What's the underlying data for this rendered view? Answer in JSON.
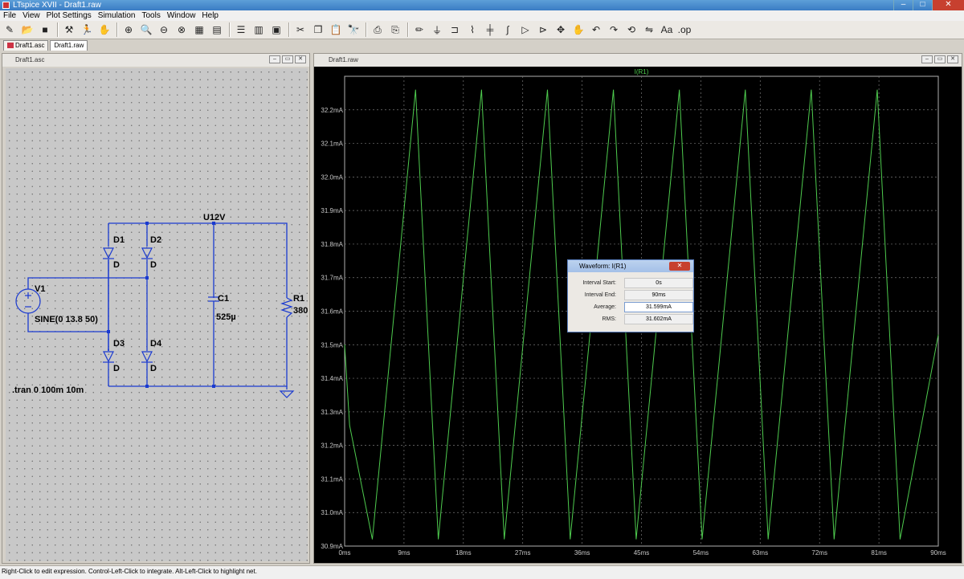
{
  "window": {
    "title": "LTspice XVII - Draft1.raw"
  },
  "menu": [
    "File",
    "View",
    "Plot Settings",
    "Simulation",
    "Tools",
    "Window",
    "Help"
  ],
  "tabs": [
    "Draft1.asc",
    "Draft1.raw"
  ],
  "schematic": {
    "title": "Draft1.asc",
    "net_label": "U12V",
    "diodes": [
      {
        "name": "D1",
        "value": "D"
      },
      {
        "name": "D2",
        "value": "D"
      },
      {
        "name": "D3",
        "value": "D"
      },
      {
        "name": "D4",
        "value": "D"
      }
    ],
    "source": {
      "name": "V1",
      "value": "SINE(0 13.8 50)"
    },
    "capacitor": {
      "name": "C1",
      "value": "525µ"
    },
    "resistor": {
      "name": "R1",
      "value": "380"
    },
    "directive": ".tran 0 100m 10m"
  },
  "waveform_window": {
    "title": "Draft1.raw"
  },
  "chart_data": {
    "type": "line",
    "title": "I(R1)",
    "xlabel": "",
    "ylabel": "",
    "x_ticks": [
      "0ms",
      "9ms",
      "18ms",
      "27ms",
      "36ms",
      "45ms",
      "54ms",
      "63ms",
      "72ms",
      "81ms",
      "90ms"
    ],
    "y_ticks": [
      "30.9mA",
      "31.0mA",
      "31.1mA",
      "31.2mA",
      "31.3mA",
      "31.4mA",
      "31.5mA",
      "31.6mA",
      "31.7mA",
      "31.8mA",
      "31.9mA",
      "32.0mA",
      "32.1mA",
      "32.2mA"
    ],
    "xlim": [
      0,
      90
    ],
    "ylim": [
      30.9,
      32.3
    ],
    "grid": true,
    "trace_color": "#4ecb4e",
    "series": [
      {
        "name": "I(R1)",
        "x": [
          0,
          0.75,
          4.2,
          10.75,
          14.2,
          20.75,
          24.2,
          30.75,
          34.2,
          40.75,
          44.2,
          50.75,
          54.2,
          60.75,
          64.2,
          70.75,
          74.2,
          80.75,
          84.2,
          90
        ],
        "values": [
          31.5,
          31.26,
          30.92,
          32.26,
          30.92,
          32.26,
          30.92,
          32.26,
          30.92,
          32.26,
          30.92,
          32.26,
          30.92,
          32.26,
          30.92,
          32.26,
          30.92,
          32.26,
          30.92,
          31.53
        ]
      }
    ]
  },
  "dialog": {
    "title": "Waveform: I(R1)",
    "close": "✕",
    "fields": [
      {
        "label": "Interval Start:",
        "value": "0s"
      },
      {
        "label": "Interval End:",
        "value": "90ms"
      },
      {
        "label": "Average:",
        "value": "31.599mA"
      },
      {
        "label": "RMS:",
        "value": "31.602mA"
      }
    ]
  },
  "status": "Right-Click to edit expression. Control-Left-Click to integrate. Alt-Left-Click to highlight net.",
  "colors": {
    "wire": "#1a3ad0",
    "trace": "#4ecb4e",
    "axis": "#b0b0b0",
    "close": "#c7402f"
  }
}
